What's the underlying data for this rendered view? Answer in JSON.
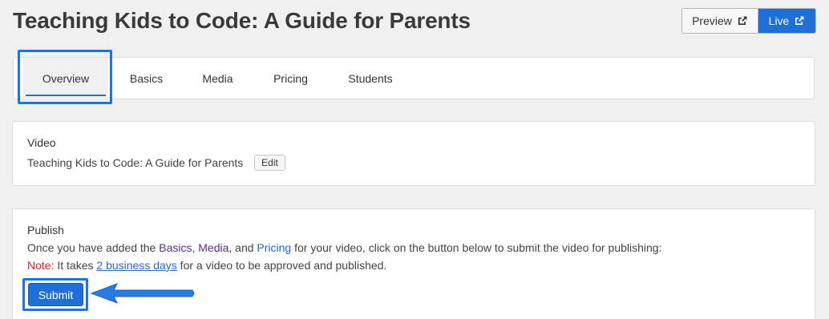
{
  "page": {
    "title": "Teaching Kids to Code: A Guide for Parents"
  },
  "header": {
    "preview_label": "Preview",
    "live_label": "Live",
    "icon": "external-link-icon"
  },
  "tabs": [
    {
      "label": "Overview",
      "active": true
    },
    {
      "label": "Basics",
      "active": false
    },
    {
      "label": "Media",
      "active": false
    },
    {
      "label": "Pricing",
      "active": false
    },
    {
      "label": "Students",
      "active": false
    }
  ],
  "video_card": {
    "label": "Video",
    "video_title": "Teaching Kids to Code: A Guide for Parents",
    "edit_label": "Edit"
  },
  "publish_card": {
    "label": "Publish",
    "line1_prefix": "Once you have added the ",
    "link_basics": "Basics",
    "sep1": ", ",
    "link_media": "Media",
    "sep2": ", and ",
    "link_pricing": "Pricing",
    "line1_suffix": " for your video, click on the button below to submit the video for publishing:",
    "note_label": "Note:",
    "note_prefix": " It takes ",
    "note_link": "2 business days",
    "note_suffix": " for a video to be approved and published.",
    "submit_label": "Submit"
  },
  "colors": {
    "accent": "#1f6fd8",
    "highlight": "#1a73e8",
    "note_red": "#e02020",
    "visited_link": "#5a2d91"
  }
}
